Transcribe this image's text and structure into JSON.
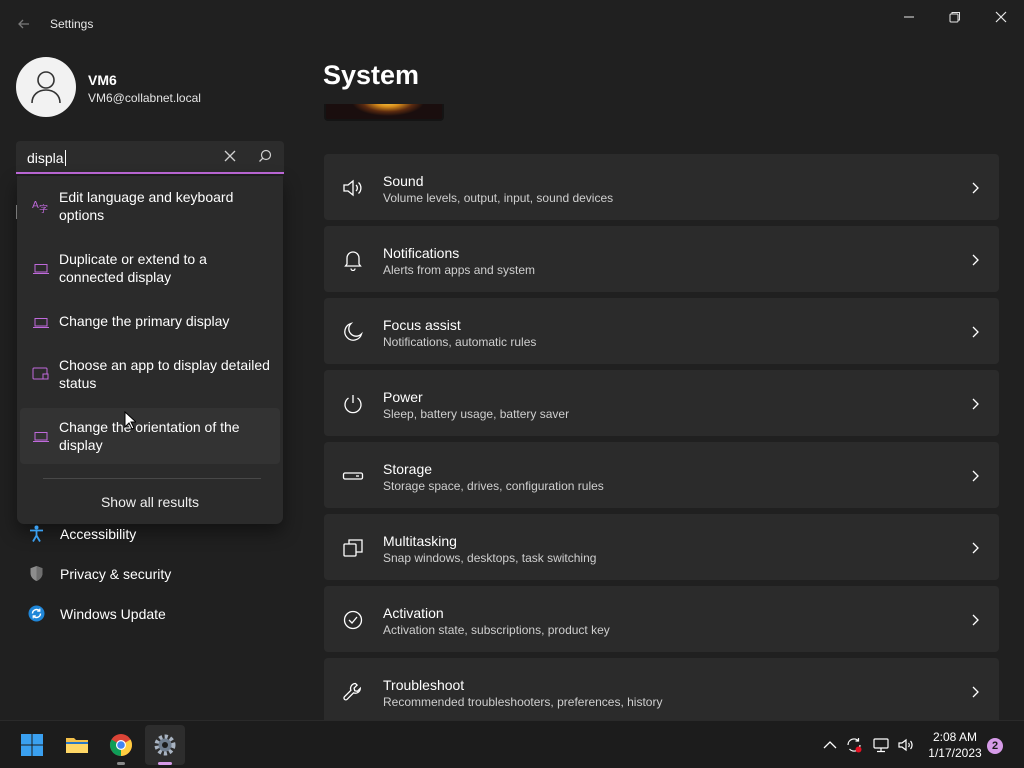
{
  "window": {
    "title": "Settings"
  },
  "profile": {
    "name": "VM6",
    "email": "VM6@collabnet.local"
  },
  "search": {
    "value": "displa",
    "suggestions": [
      {
        "label": "Edit language and keyboard options",
        "icon": "language-keyboard-icon"
      },
      {
        "label": "Duplicate or extend to a connected display",
        "icon": "laptop-display-icon"
      },
      {
        "label": "Change the primary display",
        "icon": "laptop-display-icon"
      },
      {
        "label": "Choose an app to display detailed status",
        "icon": "lock-screen-status-icon"
      },
      {
        "label": "Change the orientation of the display",
        "icon": "laptop-display-icon"
      }
    ],
    "show_all_label": "Show all results"
  },
  "nav": {
    "items": [
      {
        "label": "Accessibility",
        "icon": "accessibility-icon"
      },
      {
        "label": "Privacy & security",
        "icon": "shield-icon"
      },
      {
        "label": "Windows Update",
        "icon": "windows-update-icon"
      }
    ]
  },
  "page": {
    "title": "System"
  },
  "cards": [
    {
      "title": "Sound",
      "subtitle": "Volume levels, output, input, sound devices",
      "icon": "speaker-icon"
    },
    {
      "title": "Notifications",
      "subtitle": "Alerts from apps and system",
      "icon": "bell-icon"
    },
    {
      "title": "Focus assist",
      "subtitle": "Notifications, automatic rules",
      "icon": "moon-icon"
    },
    {
      "title": "Power",
      "subtitle": "Sleep, battery usage, battery saver",
      "icon": "power-icon"
    },
    {
      "title": "Storage",
      "subtitle": "Storage space, drives, configuration rules",
      "icon": "storage-drive-icon"
    },
    {
      "title": "Multitasking",
      "subtitle": "Snap windows, desktops, task switching",
      "icon": "multitasking-icon"
    },
    {
      "title": "Activation",
      "subtitle": "Activation state, subscriptions, product key",
      "icon": "check-circle-icon"
    },
    {
      "title": "Troubleshoot",
      "subtitle": "Recommended troubleshooters, preferences, history",
      "icon": "wrench-icon"
    }
  ],
  "taskbar": {
    "apps": [
      {
        "name": "Start",
        "icon": "windows-start-icon"
      },
      {
        "name": "File Explorer",
        "icon": "folder-icon"
      },
      {
        "name": "Google Chrome",
        "icon": "chrome-icon"
      },
      {
        "name": "Settings",
        "icon": "gear-icon"
      }
    ],
    "time": "2:08 AM",
    "date": "1/17/2023",
    "notification_count": "2"
  },
  "colors": {
    "accent": "#c06adc",
    "background": "#202020",
    "card": "#2b2b2b",
    "taskbar_accent": "#d69be8"
  }
}
